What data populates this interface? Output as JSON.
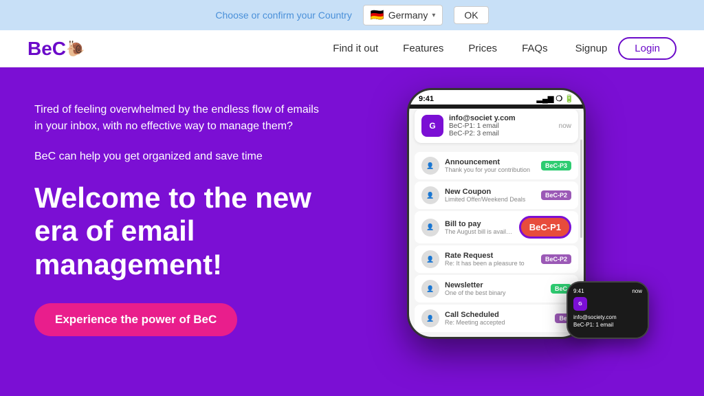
{
  "topbar": {
    "prompt": "Choose or confirm your Country",
    "flag": "🇩🇪",
    "country": "Germany",
    "ok_label": "OK"
  },
  "navbar": {
    "logo": "BeC",
    "links": [
      {
        "label": "Find it out",
        "id": "find-it-out"
      },
      {
        "label": "Features",
        "id": "features"
      },
      {
        "label": "Prices",
        "id": "prices"
      },
      {
        "label": "FAQs",
        "id": "faqs"
      }
    ],
    "signup_label": "Signup",
    "login_label": "Login"
  },
  "hero": {
    "subtitle": "Tired of feeling overwhelmed by the endless flow of emails in your inbox, with no effective way to manage them?",
    "mid_text": "BeC can help you get organized and save time",
    "title": "Welcome to the new era of email management!",
    "cta_label": "Experience the power of BeC"
  },
  "phone": {
    "time": "9:41",
    "signal": "▂▄▆",
    "wifi": "WiFi",
    "battery": "🔋",
    "notification": {
      "sender": "info@societ y.com",
      "line1": "BeC-P1: 1 email",
      "line2": "BeC-P2: 3 email",
      "time": "now"
    },
    "emails": [
      {
        "subject": "Announcement",
        "preview": "Thank you for your contribution",
        "tag": "BeC-P3",
        "tag_class": "tag-p3"
      },
      {
        "subject": "New Coupon",
        "preview": "Limited Offer/Weekend Deals",
        "tag": "BeC-P2",
        "tag_class": "tag-p2"
      },
      {
        "subject": "Bill to pay",
        "preview": "The August bill is available",
        "tag": "BeC-P1",
        "tag_class": "tag-p1-large"
      },
      {
        "subject": "Rate Request",
        "preview": "Re: It has been a pleasure to",
        "tag": "BeC-P2",
        "tag_class": "tag-p2"
      },
      {
        "subject": "Newsletter",
        "preview": "One of the best binary",
        "tag": "BeC",
        "tag_class": "tag-p3"
      },
      {
        "subject": "Call Scheduled",
        "preview": "Re: Meeting accepted",
        "tag": "Be",
        "tag_class": "tag-p2"
      }
    ]
  },
  "watch": {
    "time": "9:41",
    "label": "now",
    "sender": "info@society.com",
    "line": "BeC-P1: 1 email"
  }
}
